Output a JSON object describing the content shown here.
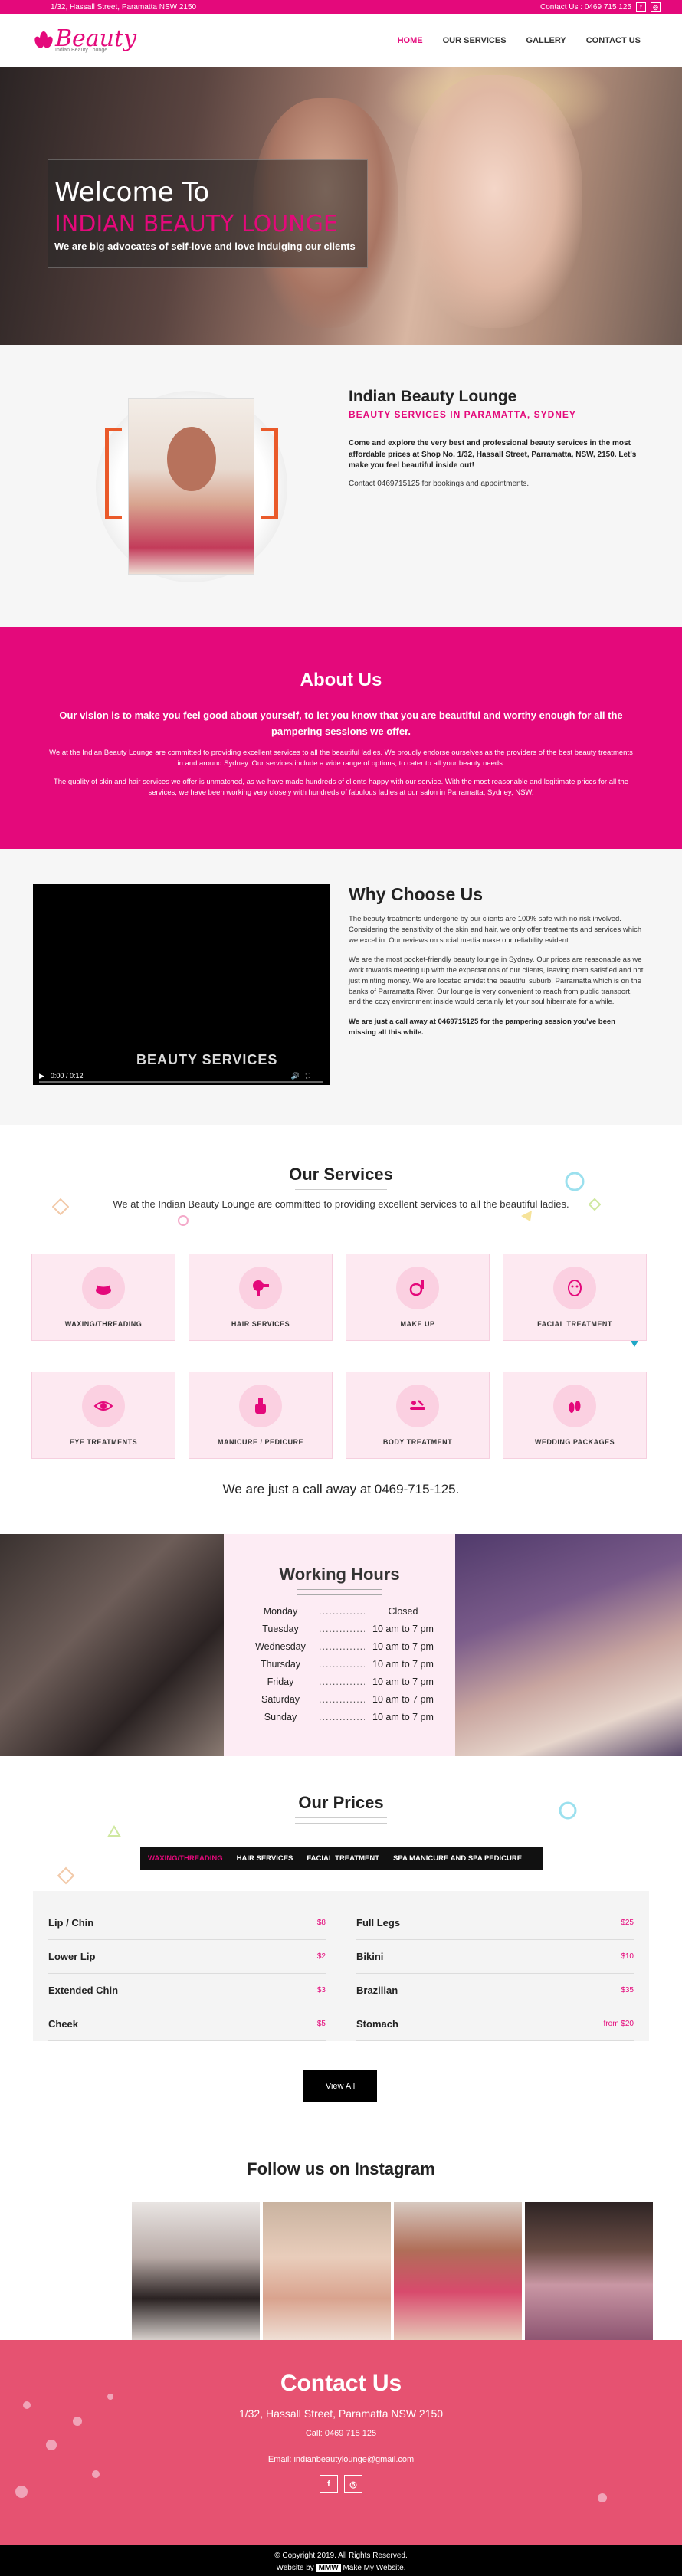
{
  "topbar": {
    "address": "1/32, Hassall Street, Paramatta NSW 2150",
    "contact": "Contact Us : 0469 715 125",
    "fb_icon": "f",
    "ig_icon": "◎"
  },
  "brand": {
    "logo_text": "Beauty",
    "logo_sub": "Indian Beauty Lounge"
  },
  "nav": {
    "items": [
      "HOME",
      "OUR SERVICES",
      "GALLERY",
      "CONTACT US"
    ]
  },
  "hero": {
    "line1": "Welcome To",
    "line2": "INDIAN BEAUTY LOUNGE",
    "tagline": "We are big advocates of self-love and love indulging our clients"
  },
  "intro": {
    "title": "Indian Beauty Lounge",
    "subtitle": "BEAUTY SERVICES IN PARAMATTA, SYDNEY",
    "bold_text": "Come and explore the very best and professional beauty services in the most affordable prices at Shop No. 1/32, Hassall Street, Parramatta, NSW, 2150. Let's make you feel beautiful inside out!",
    "contact_text": "Contact 0469715125 for bookings and appointments."
  },
  "about": {
    "title": "About Us",
    "lead": "Our vision is to make you feel good about yourself, to let you know that you are beautiful and worthy enough for all the pampering sessions we offer.",
    "p1": "We at the Indian Beauty Lounge are committed to providing excellent services to all the beautiful ladies. We proudly endorse ourselves as the providers of the best beauty treatments in and around Sydney. Our services include a wide range of options, to cater to all your beauty needs.",
    "p2": "The quality of skin and hair services we offer is unmatched, as we have made hundreds of clients happy with our service. With the most reasonable and legitimate prices for all the services, we have been working very closely with hundreds of fabulous ladies at our salon in Parramatta, Sydney, NSW."
  },
  "why": {
    "title": "Why Choose Us",
    "video_overlay": "BEAUTY SERVICES",
    "video_time": "0:00 / 0:12",
    "p1": "The beauty treatments undergone by our clients are 100% safe with no risk involved. Considering the sensitivity of the skin and hair, we only offer treatments and services which we excel in. Our reviews on social media make our reliability evident.",
    "p2": "We are the most pocket-friendly beauty lounge in Sydney. Our prices are reasonable as we work towards meeting up with the expectations of our clients, leaving them satisfied and not just minting money. We are located amidst the beautiful suburb, Parramatta which is on the banks of Parramatta River. Our lounge is very convenient to reach from public transport, and the cozy environment inside would certainly let your soul hibernate for a while.",
    "p3": "We are just a call away at 0469715125 for the pampering session you've been missing all this while."
  },
  "services": {
    "title": "Our Services",
    "subtitle": "We at the Indian Beauty Lounge are committed to providing excellent services to all the beautiful ladies.",
    "items": [
      {
        "label": "WAXING/THREADING",
        "icon": "wax-bowl-icon"
      },
      {
        "label": "HAIR SERVICES",
        "icon": "hair-dryer-icon"
      },
      {
        "label": "MAKE UP",
        "icon": "makeup-icon"
      },
      {
        "label": "FACIAL TREATMENT",
        "icon": "facial-icon"
      },
      {
        "label": "EYE TREATMENTS",
        "icon": "eye-icon"
      },
      {
        "label": "MANICURE / PEDICURE",
        "icon": "nail-polish-icon"
      },
      {
        "label": "BODY TREATMENT",
        "icon": "massage-icon"
      },
      {
        "label": "WEDDING PACKAGES",
        "icon": "feet-icon"
      }
    ],
    "call": "We are just a call away at 0469-715-125."
  },
  "hours": {
    "title": "Working Hours",
    "rows": [
      {
        "day": "Monday",
        "time": "Closed"
      },
      {
        "day": "Tuesday",
        "time": "10 am to 7 pm"
      },
      {
        "day": "Wednesday",
        "time": "10 am to 7 pm"
      },
      {
        "day": "Thursday",
        "time": "10 am to 7 pm"
      },
      {
        "day": "Friday",
        "time": "10 am to 7 pm"
      },
      {
        "day": "Saturday",
        "time": "10 am to 7 pm"
      },
      {
        "day": "Sunday",
        "time": "10 am to 7 pm"
      }
    ]
  },
  "prices": {
    "title": "Our Prices",
    "tabs": [
      "WAXING/THREADING",
      "HAIR SERVICES",
      "FACIAL TREATMENT",
      "SPA MANICURE AND SPA PEDICURE"
    ],
    "items": [
      {
        "name": "Lip / Chin",
        "price": "$8"
      },
      {
        "name": "Full Legs",
        "price": "$25"
      },
      {
        "name": "Lower Lip",
        "price": "$2"
      },
      {
        "name": "Bikini",
        "price": "$10"
      },
      {
        "name": "Extended Chin",
        "price": "$3"
      },
      {
        "name": "Brazilian",
        "price": "$35"
      },
      {
        "name": "Cheek",
        "price": "$5"
      },
      {
        "name": "Stomach",
        "price": "from $20"
      }
    ],
    "view_all": "View All"
  },
  "instagram": {
    "title": "Follow us on Instagram"
  },
  "contact": {
    "title": "Contact Us",
    "address": "1/32, Hassall Street, Paramatta NSW 2150",
    "phone": "Call: 0469 715 125",
    "email": "Email: indianbeautylounge@gmail.com"
  },
  "footer": {
    "copyright": "© Copyright 2019. All Rights Reserved.",
    "credit_pre": "Website by",
    "credit_logo": "MMW",
    "credit_post": "Make My Website."
  },
  "colors": {
    "brand_pink": "#e4097b",
    "contact_bg": "#e65271"
  }
}
